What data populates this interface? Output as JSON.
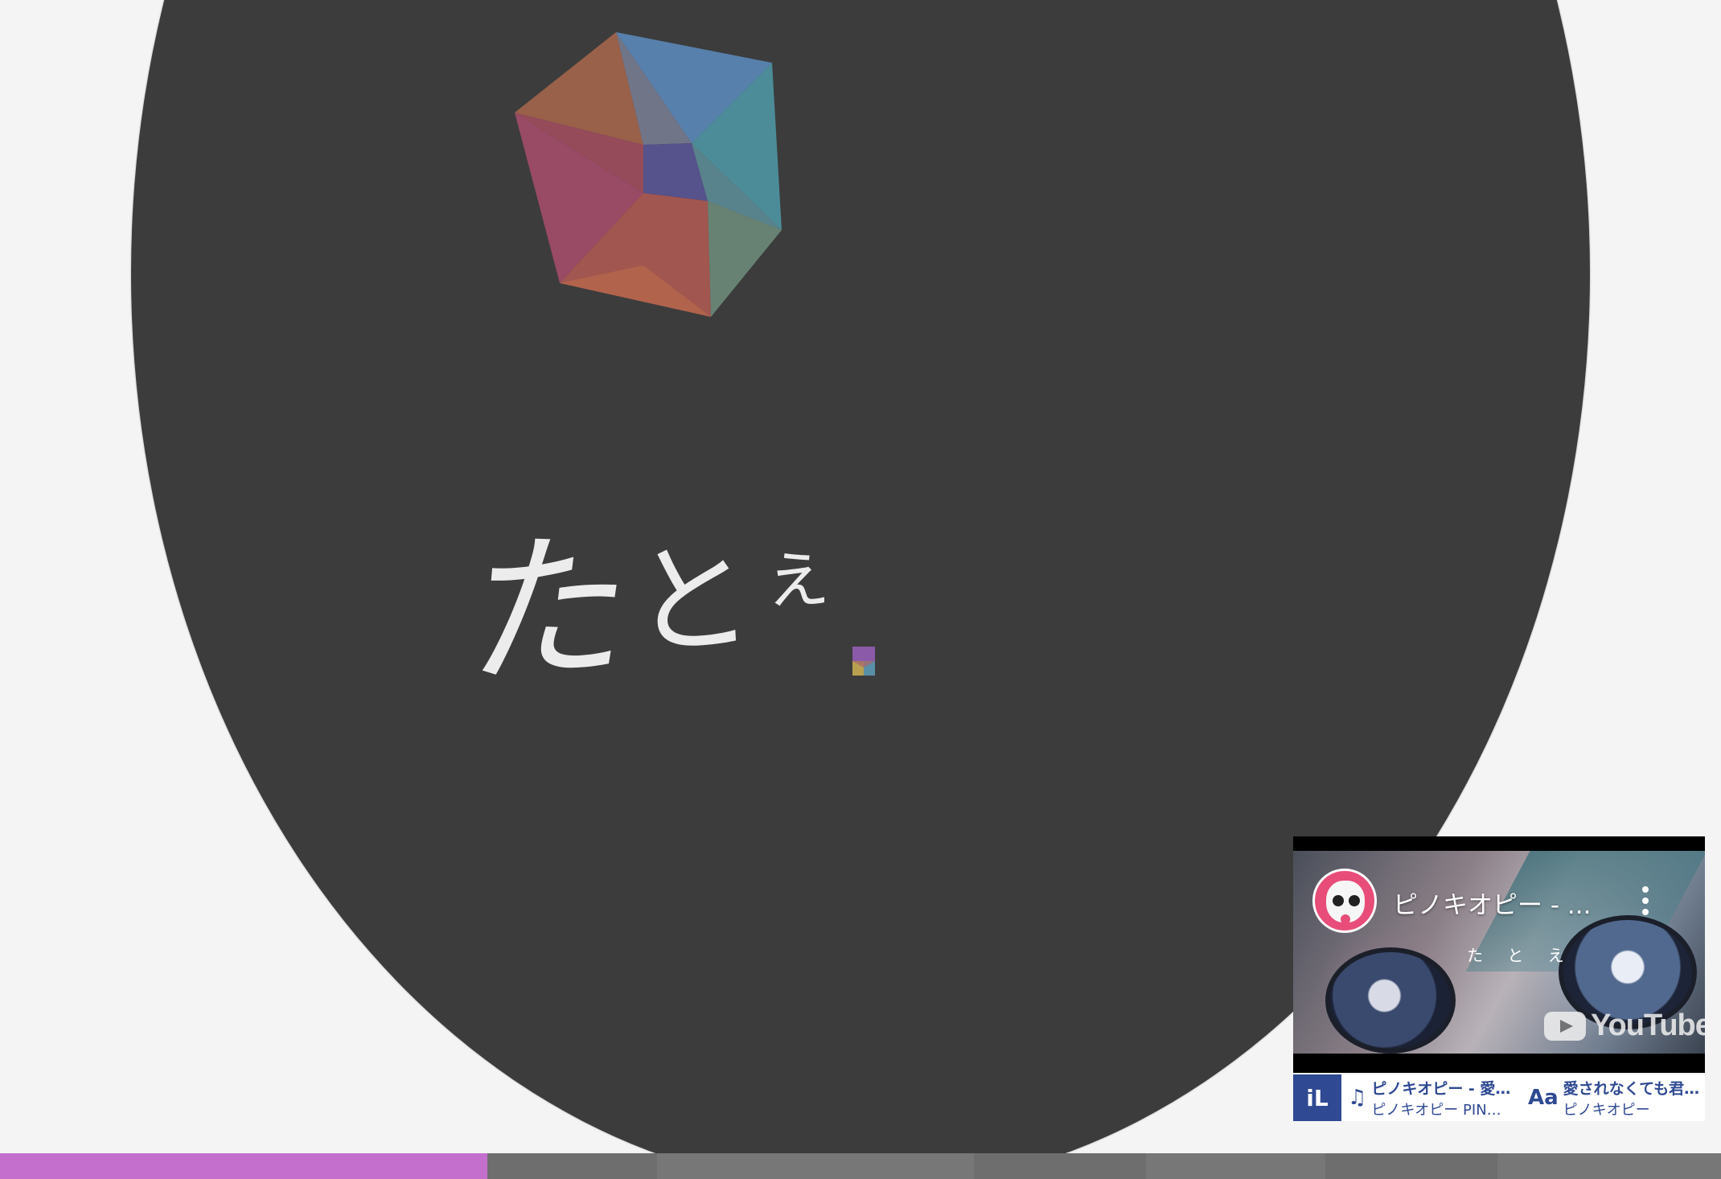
{
  "stage": {
    "background_color": "#f4f4f4",
    "disc_color": "#3c3c3c"
  },
  "lyric": {
    "chars": [
      "た",
      "と",
      "え"
    ]
  },
  "player": {
    "channel_avatar_icon": "pinocchiop-avatar-icon",
    "video_title": "ピノキオピー - ...",
    "video_lyric": "た と え",
    "brand_text": "YouTube",
    "menu_icon": "more-vert-icon"
  },
  "info_bar": {
    "app_badge_text": "iL",
    "song": {
      "icon": "music-note-icon",
      "title": "ピノキオピー - 愛…",
      "artist": "ピノキオピー PIN…"
    },
    "lyrics": {
      "icon": "font-aa-icon",
      "icon_text": "Aa",
      "title": "愛されなくても君…",
      "artist": "ピノキオピー"
    }
  },
  "progress": {
    "played_color": "#c46fcd",
    "played_fraction": 0.283,
    "segments": [
      {
        "fraction": 0.283,
        "state": "played"
      },
      {
        "fraction": 0.099,
        "state": "upcoming"
      },
      {
        "fraction": 0.184,
        "state": "upcoming"
      },
      {
        "fraction": 0.1,
        "state": "upcoming"
      },
      {
        "fraction": 0.104,
        "state": "upcoming"
      },
      {
        "fraction": 0.1,
        "state": "upcoming"
      },
      {
        "fraction": 0.13,
        "state": "upcoming"
      }
    ]
  }
}
